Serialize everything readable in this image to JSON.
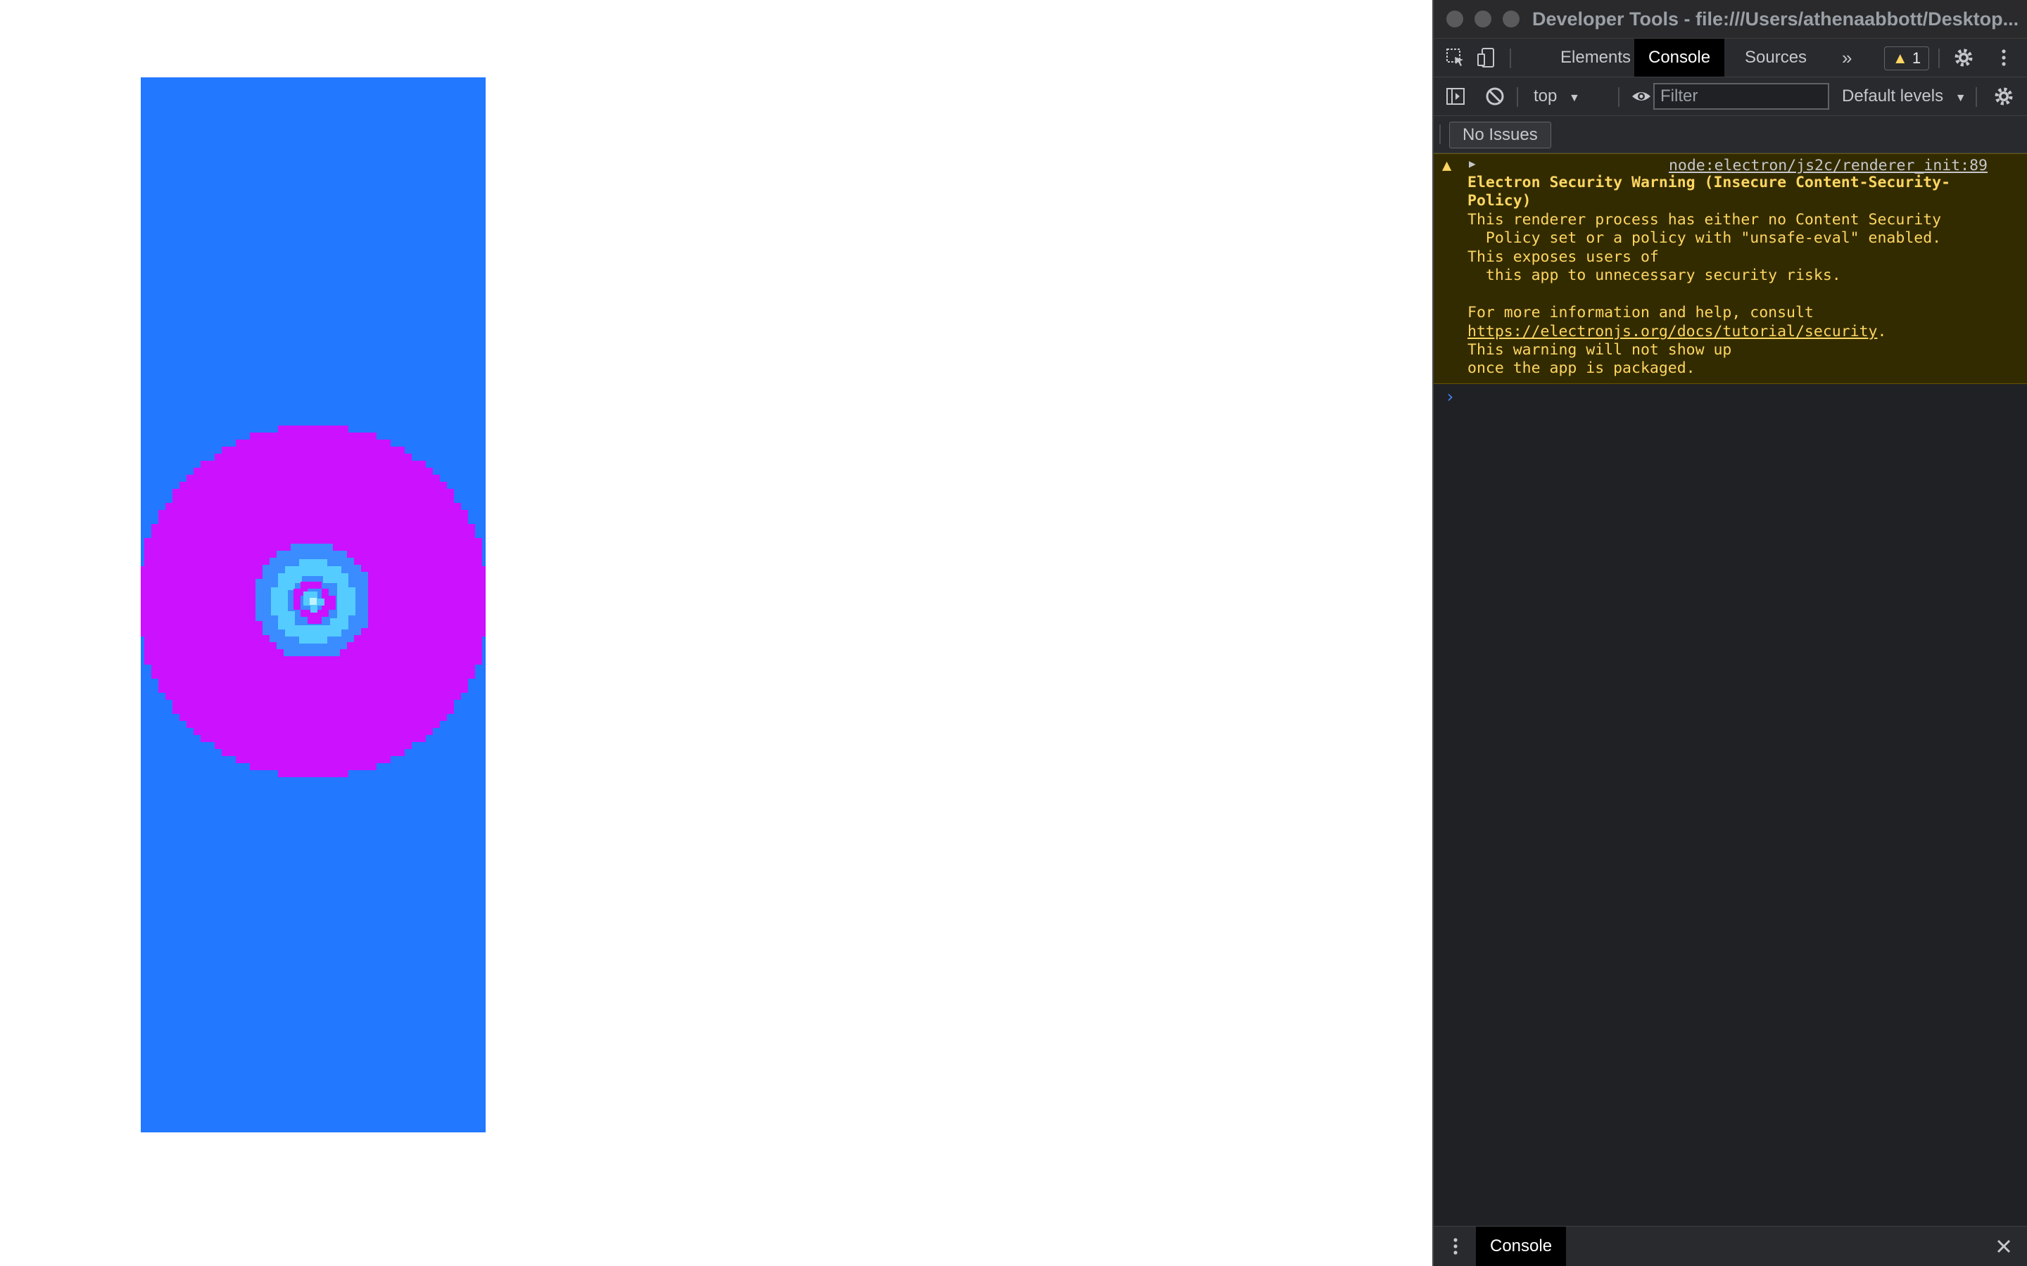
{
  "app": {
    "colors": {
      "background": "#2278ff",
      "magenta": "#cc11ff",
      "ring_blue": "#3a8cff",
      "cyan": "#55ccff",
      "light": "#bff2ff"
    }
  },
  "devtools": {
    "window_title": "Developer Tools - file:///Users/athenaabbott/Desktop...",
    "tabs": [
      "Elements",
      "Console",
      "Sources"
    ],
    "active_tab": "Console",
    "warning_count": "1",
    "context": "top",
    "filter_placeholder": "Filter",
    "levels": "Default levels",
    "no_issues": "No Issues",
    "console": {
      "source": "node:electron/js2c/renderer_init:89",
      "title_line1": "Electron Security Warning (Insecure Content-Security-",
      "title_line2": "Policy)",
      "body_line1": "This renderer process has either no Content Security",
      "body_line2": "  Policy set or a policy with \"unsafe-eval\" enabled.",
      "body_line3": "This exposes users of",
      "body_line4": "  this app to unnecessary security risks.",
      "body_line5": "For more information and help, consult",
      "link": "https://electronjs.org/docs/tutorial/security",
      "link_suffix": ".",
      "body_line6": "This warning will not show up",
      "body_line7": "once the app is packaged."
    },
    "drawer_tab": "Console",
    "icons": [
      "inspect-icon",
      "device-toolbar-icon",
      "more-tabs-icon",
      "settings-icon",
      "kebab-menu-icon",
      "sidebar-toggle-icon",
      "clear-console-icon",
      "eye-icon",
      "drawer-menu-icon",
      "close-icon",
      "warning-icon",
      "expand-arrow-icon"
    ]
  }
}
